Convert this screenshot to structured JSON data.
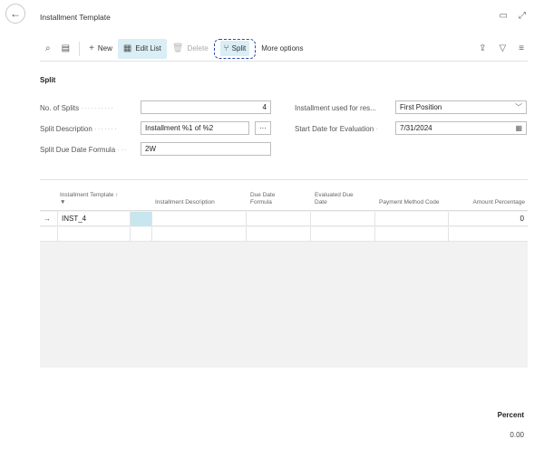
{
  "header": {
    "title": "Installment Template"
  },
  "toolbar": {
    "new_label": "New",
    "edit_list_label": "Edit List",
    "delete_label": "Delete",
    "split_label": "Split",
    "more_options_label": "More options"
  },
  "section": {
    "title": "Split"
  },
  "fields": {
    "no_of_splits_label": "No. of Splits",
    "no_of_splits_value": "4",
    "split_description_label": "Split Description",
    "split_description_value": "Installment %1 of %2",
    "split_due_date_formula_label": "Split Due Date Formula",
    "split_due_date_formula_value": "2W",
    "installment_used_label": "Installment used for res...",
    "installment_used_value": "First Position",
    "start_date_label": "Start Date for Evaluation",
    "start_date_value": "7/31/2024"
  },
  "grid": {
    "columns": {
      "template": "Installment Template ↑ ▼",
      "description": "Installment Description",
      "due_date_formula": "Due Date Formula",
      "evaluated_due_date": "Evaluated Due Date",
      "payment_method_code": "Payment Method Code",
      "amount_percentage": "Amount Percentage"
    },
    "rows": [
      {
        "marker": "→",
        "template": "INST_4",
        "description": "",
        "due_date_formula": "",
        "evaluated_due_date": "",
        "payment_method_code": "",
        "amount_percentage": "0"
      }
    ]
  },
  "footer": {
    "percent_label": "Percent",
    "percent_value": "0.00"
  }
}
